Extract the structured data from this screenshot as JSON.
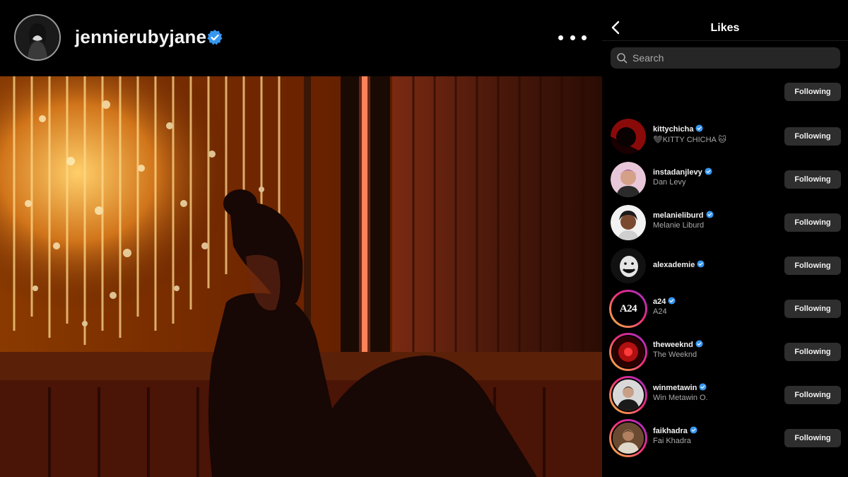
{
  "post": {
    "username": "jennierubyjane"
  },
  "likes_panel": {
    "title": "Likes",
    "search_placeholder": "Search",
    "top_button_label": "Following",
    "users": [
      {
        "username": "kittychicha",
        "full_name": "🖤KITTY CHICHA 🐱",
        "button": "Following",
        "story": false
      },
      {
        "username": "instadanjlevy",
        "full_name": "Dan Levy",
        "button": "Following",
        "story": false
      },
      {
        "username": "melanieliburd",
        "full_name": "Melanie Liburd",
        "button": "Following",
        "story": false
      },
      {
        "username": "alexademie",
        "full_name": "",
        "button": "Following",
        "story": false
      },
      {
        "username": "a24",
        "full_name": "A24",
        "button": "Following",
        "story": true,
        "avatar_text": "A24"
      },
      {
        "username": "theweeknd",
        "full_name": "The Weeknd",
        "button": "Following",
        "story": true
      },
      {
        "username": "winmetawin",
        "full_name": "Win Metawin O.",
        "button": "Following",
        "story": true
      },
      {
        "username": "faikhadra",
        "full_name": "Fai Khadra",
        "button": "Following",
        "story": true
      }
    ]
  },
  "colors": {
    "background": "#000000",
    "verified": "#3797f0",
    "button_bg": "#2e2e2e",
    "search_bg": "#262626",
    "secondary_text": "#a8a8a8"
  },
  "icons": {
    "back": "chevron-left-icon",
    "search": "search-icon",
    "more": "more-horizontal-icon",
    "verified": "verified-badge-icon"
  }
}
